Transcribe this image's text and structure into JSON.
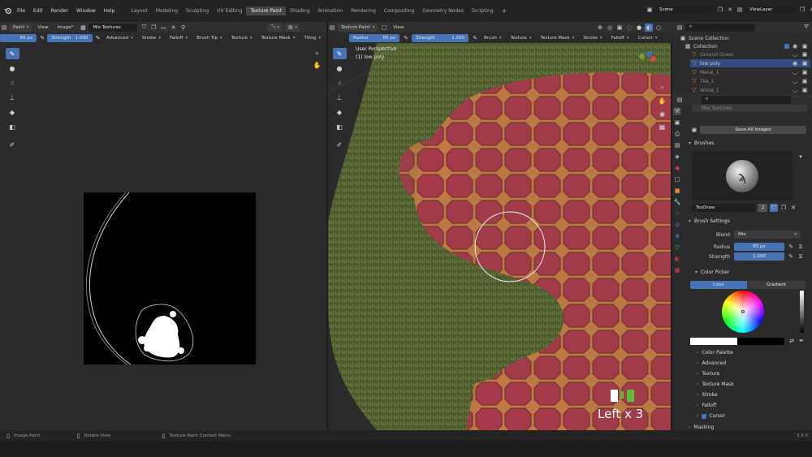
{
  "menu": [
    "File",
    "Edit",
    "Render",
    "Window",
    "Help"
  ],
  "workspaces": {
    "tabs": [
      "Layout",
      "Modeling",
      "Sculpting",
      "UV Editing",
      "Texture Paint",
      "Shading",
      "Animation",
      "Rendering",
      "Compositing",
      "Geometry Nodes",
      "Scripting"
    ],
    "active": "Texture Paint",
    "add": "+"
  },
  "scene": {
    "name": "Scene",
    "view_layer": "ViewLayer"
  },
  "image_editor": {
    "mode": "Paint",
    "view": "View",
    "image_menu": "Image*",
    "image_name": "Mix Textures",
    "radius_value": "85 px",
    "strength_label": "Strength",
    "strength_value": "1.000",
    "tool_options": [
      "Advanced",
      "Stroke",
      "Falloff",
      "Brush Tip",
      "Texture",
      "Texture Mask",
      "Tiling"
    ]
  },
  "viewport": {
    "mode": "Texture Paint",
    "view": "View",
    "radius_label": "Radius",
    "radius_value": "85 px",
    "strength_label": "Strength",
    "strength_value": "1.000",
    "tool_options": [
      "Brush",
      "Texture",
      "Texture Mask",
      "Stroke",
      "Falloff",
      "Cursor"
    ],
    "overlay_perspective": "User Perspective",
    "overlay_object": "(1) low poly",
    "caption": "Left x 3"
  },
  "outliner": {
    "root": "Scene Collection",
    "collection": "Collection",
    "items": [
      "Ground Grass",
      "low poly",
      "Metal_1",
      "Tile_1",
      "Wood_1"
    ]
  },
  "properties": {
    "image_field": "Mix Textures",
    "save_all": "Save All Images",
    "brushes_header": "Brushes",
    "brush_name": "TexDraw",
    "brush_users": "2",
    "brush_settings_header": "Brush Settings",
    "blend_label": "Blend",
    "blend_value": "Mix",
    "radius_label": "Radius",
    "radius_value": "85 px",
    "strength_label": "Strength",
    "strength_value": "1.000",
    "color_picker_header": "Color Picker",
    "color_tabs": [
      "Color",
      "Gradient"
    ],
    "subpanels": [
      "Color Palette",
      "Advanced",
      "Texture",
      "Texture Mask",
      "Stroke",
      "Falloff",
      "Cursor"
    ],
    "masking": "Masking"
  },
  "status_bar": {
    "items": [
      "Image Paint",
      "Rotate View",
      "Texture Paint Context Menu"
    ],
    "version": "3.3.0"
  },
  "colors": {
    "accent": "#4772b3",
    "panel": "#2b2b2b",
    "header": "#303030",
    "paint_red": "#a83a4b"
  }
}
